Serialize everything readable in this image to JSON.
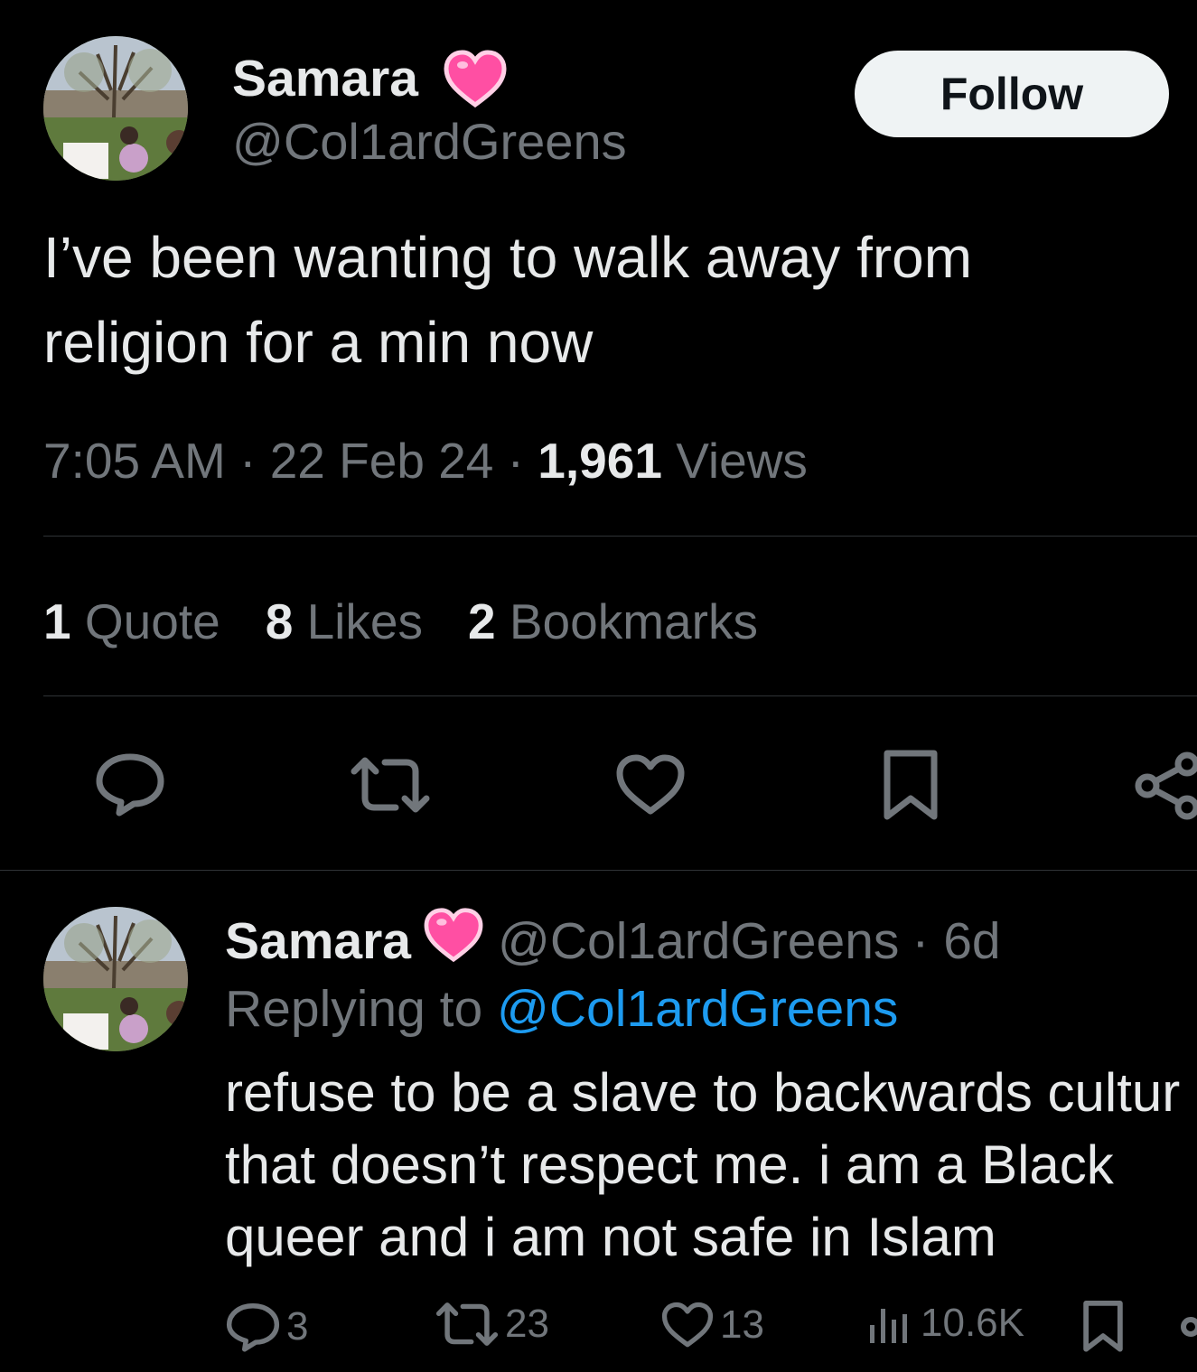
{
  "main_tweet": {
    "author_name": "Samara",
    "author_handle": "@Col1ardGreens",
    "follow_label": "Follow",
    "text_lines": [
      "I’ve been wanting to walk away from",
      "religion for a min now"
    ],
    "time": "7:05 AM",
    "date": "22 Feb 24",
    "views_count": "1,961",
    "views_label": "Views",
    "separator": "·",
    "stats": {
      "quotes_count": "1",
      "quotes_label": "Quote",
      "likes_count": "8",
      "likes_label": "Likes",
      "bookmarks_count": "2",
      "bookmarks_label": "Bookmarks"
    },
    "actions": [
      "reply-icon",
      "retweet-icon",
      "heart-icon",
      "bookmark-icon",
      "share-icon"
    ]
  },
  "reply_tweet": {
    "author_name": "Samara",
    "author_handle": "@Col1ardGreens",
    "time_ago": "· 6d",
    "replying_prefix": "Replying to",
    "replying_mention": "@Col1ardGreens",
    "text_lines": [
      "refuse to be a slave to backwards cultur",
      "that doesn’t respect me. i am a Black",
      "queer and i am not safe in Islam"
    ],
    "reply_count": "3",
    "retweet_count": "23",
    "like_count": "13",
    "view_count": "10.6K"
  },
  "colors": {
    "background": "#000000",
    "text_primary": "#e7e9ea",
    "text_secondary": "#71767b",
    "link": "#1d9bf0",
    "divider": "#2f3336",
    "follow_bg": "#eff3f4",
    "heart_emoji": "#ff4fa3"
  }
}
